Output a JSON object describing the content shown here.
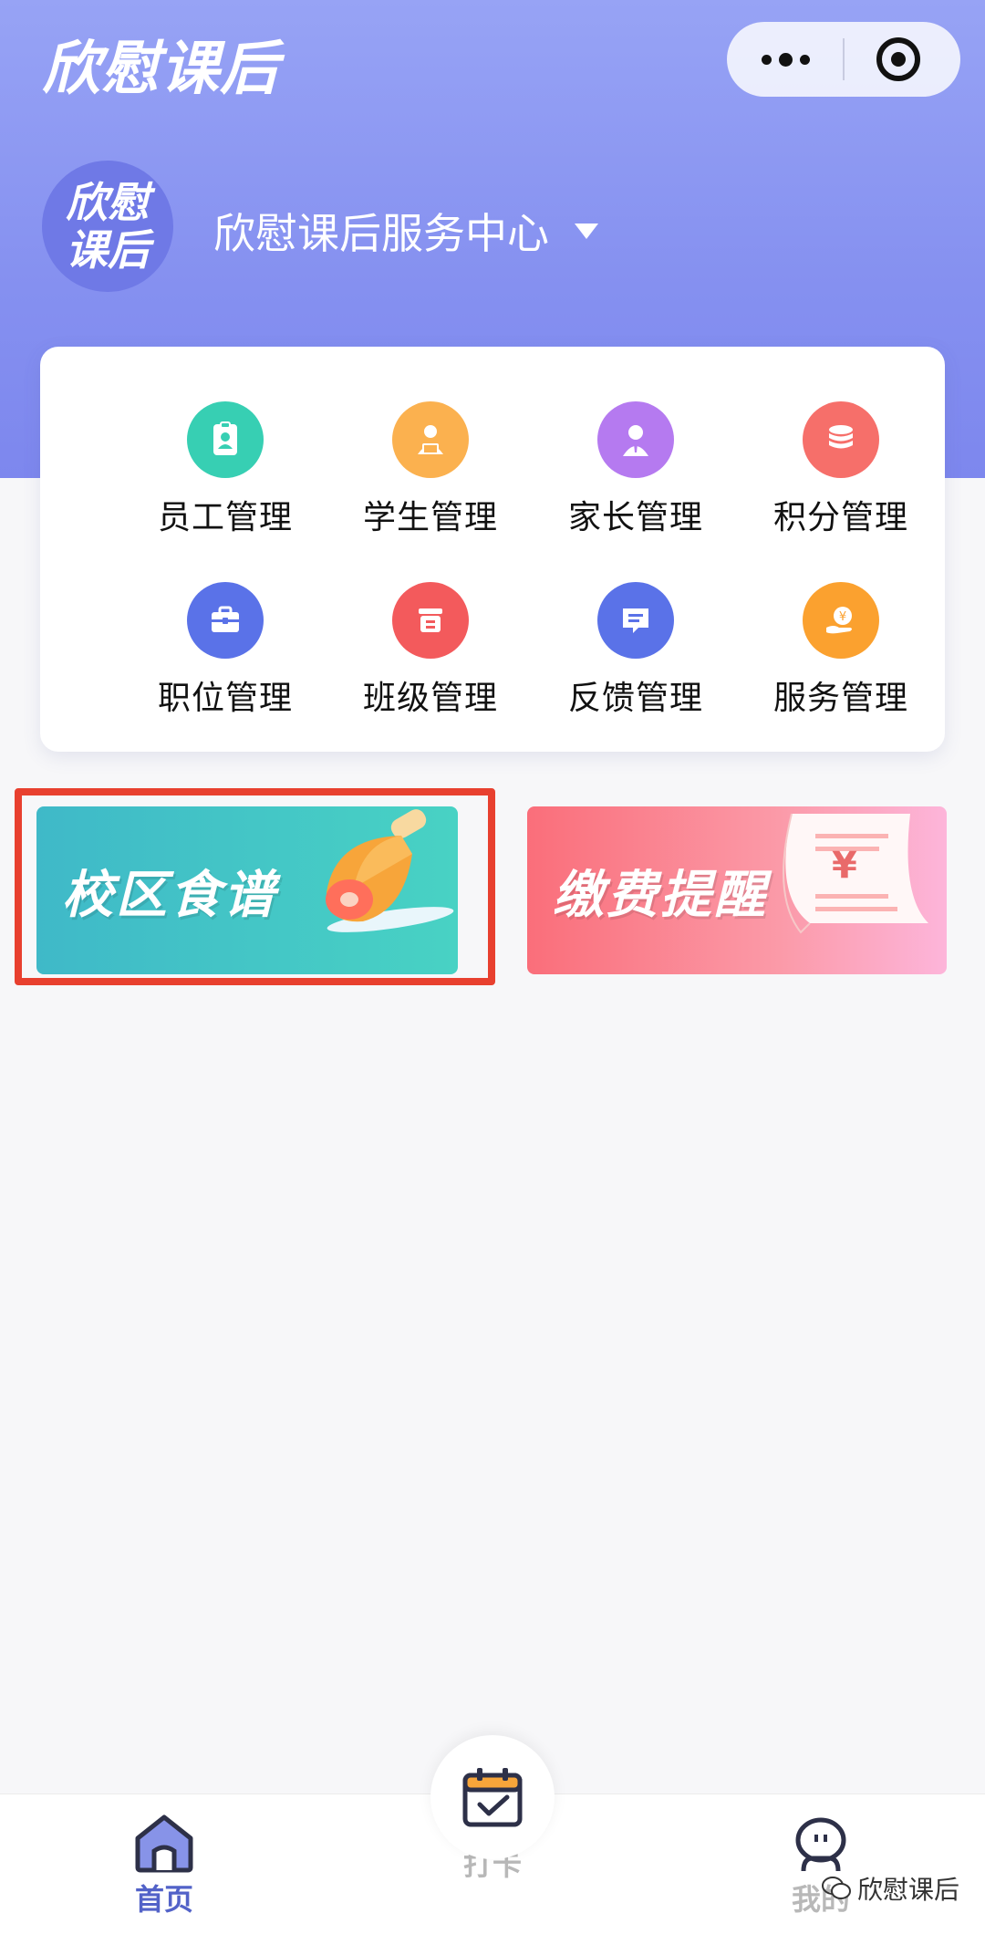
{
  "header": {
    "app_title": "欣慰课后",
    "logo_line1": "欣慰",
    "logo_line2": "课后",
    "center_name": "欣慰课后服务中心"
  },
  "menu": {
    "items": [
      {
        "label": "员工管理",
        "icon": "badge-icon",
        "color": "#37cfb3"
      },
      {
        "label": "学生管理",
        "icon": "student-icon",
        "color": "#fbb14f"
      },
      {
        "label": "家长管理",
        "icon": "parent-icon",
        "color": "#b57af0"
      },
      {
        "label": "积分管理",
        "icon": "coins-icon",
        "color": "#f66f6a"
      },
      {
        "label": "职位管理",
        "icon": "briefcase-icon",
        "color": "#5a72e8"
      },
      {
        "label": "班级管理",
        "icon": "class-icon",
        "color": "#f35a5c"
      },
      {
        "label": "反馈管理",
        "icon": "message-icon",
        "color": "#5a72e8"
      },
      {
        "label": "服务管理",
        "icon": "service-icon",
        "color": "#fba12f"
      }
    ]
  },
  "banners": {
    "food": "校区食谱",
    "fee": "缴费提醒",
    "fee_symbol": "¥"
  },
  "tabbar": {
    "home": "首页",
    "checkin": "打卡",
    "mine": "我的",
    "active_color": "#5262c8",
    "inactive_color": "#b8b8b8"
  },
  "watermark": "欣慰课后"
}
